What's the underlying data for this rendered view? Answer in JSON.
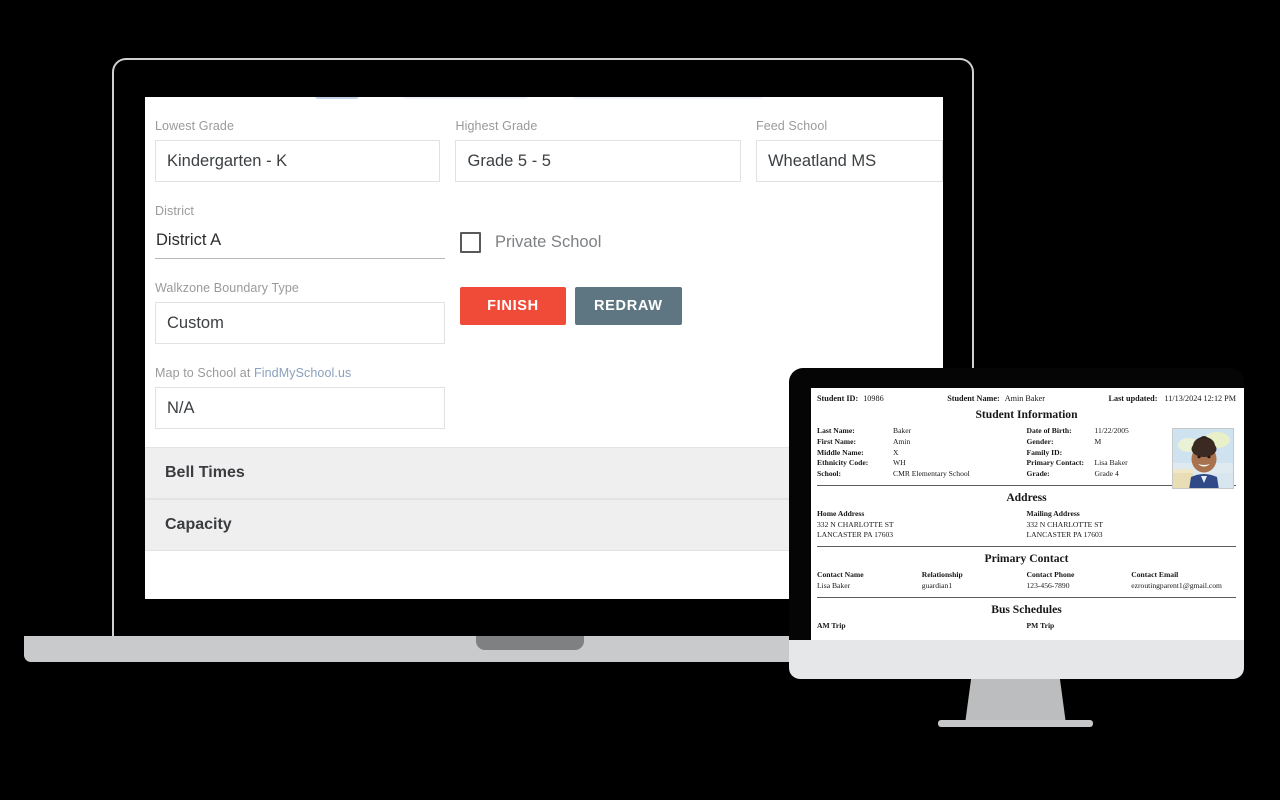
{
  "laptop": {
    "form": {
      "lowest_grade": {
        "label": "Lowest Grade",
        "value": "Kindergarten - K"
      },
      "highest_grade": {
        "label": "Highest Grade",
        "value": "Grade 5 - 5"
      },
      "feed_school": {
        "label": "Feed School",
        "value": "Wheatland MS"
      },
      "district": {
        "label": "District",
        "value": "District A"
      },
      "private_school": {
        "label": "Private School",
        "checked": false
      },
      "walkzone": {
        "label": "Walkzone Boundary Type",
        "value": "Custom"
      },
      "map_to_school": {
        "label_prefix": "Map to School at ",
        "label_link": "FindMySchool.us",
        "value": "N/A"
      },
      "buttons": {
        "finish": "FINISH",
        "redraw": "REDRAW",
        "finish_color": "#f04b38",
        "redraw_color": "#5e7682"
      }
    },
    "accordion": [
      {
        "label": "Bell Times"
      },
      {
        "label": "Capacity"
      }
    ]
  },
  "monitor": {
    "document": {
      "header": {
        "student_id_label": "Student ID:",
        "student_id_value": "10986",
        "student_name_label": "Student Name:",
        "student_name_value": "Amin Baker",
        "last_updated_label": "Last updated:",
        "last_updated_value": "11/13/2024 12:12 PM"
      },
      "sections": {
        "student_information": {
          "title": "Student Information",
          "left": [
            {
              "k": "Last Name:",
              "v": "Baker"
            },
            {
              "k": "First Name:",
              "v": "Amin"
            },
            {
              "k": "Middle Name:",
              "v": "X"
            },
            {
              "k": "Ethnicity Code:",
              "v": "WH"
            },
            {
              "k": "School:",
              "v": "CMR Elementary School"
            }
          ],
          "right": [
            {
              "k": "Date of Birth:",
              "v": "11/22/2005"
            },
            {
              "k": "Gender:",
              "v": "M"
            },
            {
              "k": "Family ID:",
              "v": ""
            },
            {
              "k": "Primary Contact:",
              "v": "Lisa Baker"
            },
            {
              "k": "Grade:",
              "v": "Grade 4"
            }
          ],
          "photo_alt": "student-photo"
        },
        "address": {
          "title": "Address",
          "home": {
            "heading": "Home Address",
            "line1": "332 N CHARLOTTE ST",
            "line2": "LANCASTER PA 17603"
          },
          "mailing": {
            "heading": "Mailing Address",
            "line1": "332 N CHARLOTTE ST",
            "line2": "LANCASTER PA 17603"
          }
        },
        "primary_contact": {
          "title": "Primary Contact",
          "columns": [
            {
              "heading": "Contact Name",
              "value": "Lisa Baker"
            },
            {
              "heading": "Relationship",
              "value": "guardian1"
            },
            {
              "heading": "Contact Phone",
              "value": "123-456-7890"
            },
            {
              "heading": "Contact Email",
              "value": "ezroutingparent1@gmail.com"
            }
          ]
        },
        "bus_schedules": {
          "title": "Bus Schedules",
          "am_trip": "AM Trip",
          "pm_trip": "PM Trip"
        }
      }
    }
  }
}
